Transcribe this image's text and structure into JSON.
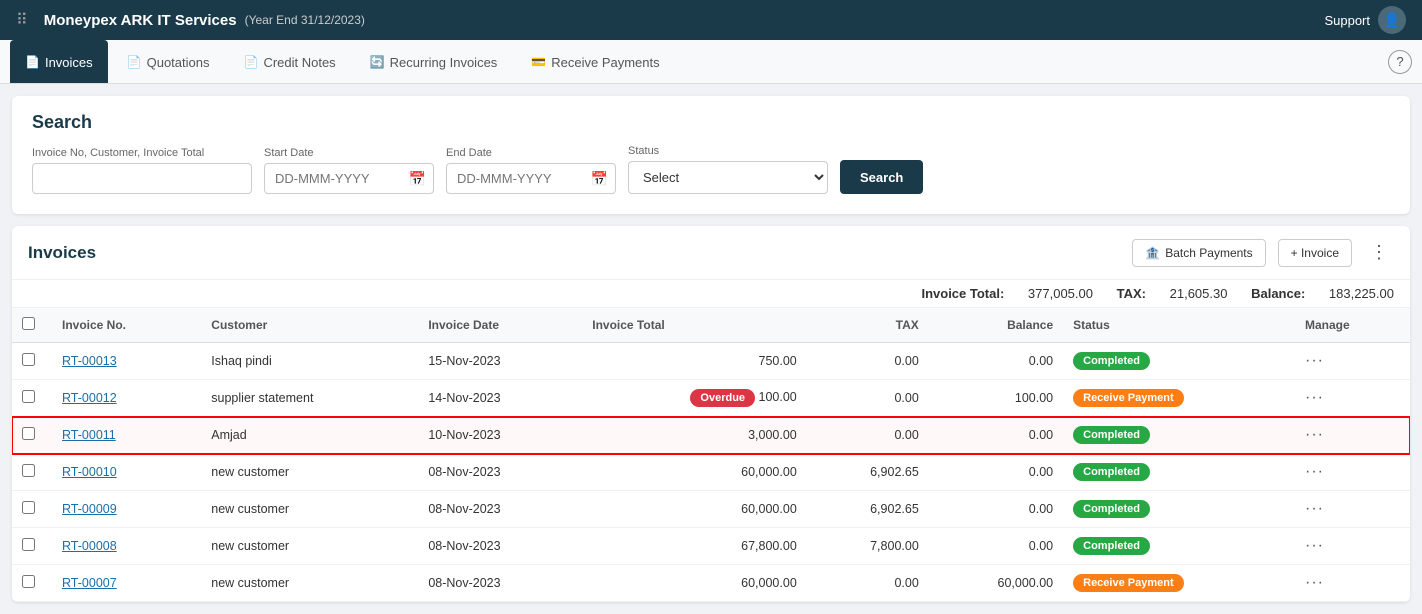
{
  "app": {
    "title": "Moneypex ARK IT Services",
    "subtitle": "(Year End 31/12/2023)",
    "support_label": "Support"
  },
  "tabs": [
    {
      "id": "invoices",
      "label": "Invoices",
      "active": true,
      "icon": "📄"
    },
    {
      "id": "quotations",
      "label": "Quotations",
      "active": false,
      "icon": "📄"
    },
    {
      "id": "credit-notes",
      "label": "Credit Notes",
      "active": false,
      "icon": "📄"
    },
    {
      "id": "recurring-invoices",
      "label": "Recurring Invoices",
      "active": false,
      "icon": "🔄"
    },
    {
      "id": "receive-payments",
      "label": "Receive Payments",
      "active": false,
      "icon": "💳"
    }
  ],
  "search": {
    "title": "Search",
    "invoice_label": "Invoice No, Customer, Invoice Total",
    "invoice_placeholder": "",
    "start_date_label": "Start Date",
    "start_date_placeholder": "DD-MMM-YYYY",
    "end_date_label": "End Date",
    "end_date_placeholder": "DD-MMM-YYYY",
    "status_label": "Status",
    "status_placeholder": "Select",
    "search_button": "Search"
  },
  "invoices_section": {
    "title": "Invoices",
    "batch_payments_label": "Batch Payments",
    "add_invoice_label": "+ Invoice",
    "totals": {
      "invoice_total_label": "Invoice Total:",
      "invoice_total_value": "377,005.00",
      "tax_label": "TAX:",
      "tax_value": "21,605.30",
      "balance_label": "Balance:",
      "balance_value": "183,225.00"
    },
    "columns": [
      {
        "id": "checkbox",
        "label": ""
      },
      {
        "id": "invoice_no",
        "label": "Invoice No."
      },
      {
        "id": "customer",
        "label": "Customer"
      },
      {
        "id": "invoice_date",
        "label": "Invoice Date"
      },
      {
        "id": "invoice_total",
        "label": "Invoice Total"
      },
      {
        "id": "tax",
        "label": "TAX"
      },
      {
        "id": "balance",
        "label": "Balance"
      },
      {
        "id": "status",
        "label": "Status"
      },
      {
        "id": "manage",
        "label": "Manage"
      }
    ],
    "rows": [
      {
        "id": "RT-00013",
        "customer": "Ishaq pindi",
        "date": "15-Nov-2023",
        "invoice_total": "750.00",
        "tax": "0.00",
        "balance": "0.00",
        "status": "Completed",
        "status_type": "completed",
        "highlighted": false
      },
      {
        "id": "RT-00012",
        "customer": "supplier statement",
        "date": "14-Nov-2023",
        "invoice_total": "100.00",
        "tax": "0.00",
        "balance": "100.00",
        "status": "Receive Payment",
        "status_type": "receive",
        "overdue": true,
        "highlighted": false
      },
      {
        "id": "RT-00011",
        "customer": "Amjad",
        "date": "10-Nov-2023",
        "invoice_total": "3,000.00",
        "tax": "0.00",
        "balance": "0.00",
        "status": "Completed",
        "status_type": "completed",
        "highlighted": true
      },
      {
        "id": "RT-00010",
        "customer": "new customer",
        "date": "08-Nov-2023",
        "invoice_total": "60,000.00",
        "tax": "6,902.65",
        "balance": "0.00",
        "status": "Completed",
        "status_type": "completed",
        "highlighted": false
      },
      {
        "id": "RT-00009",
        "customer": "new customer",
        "date": "08-Nov-2023",
        "invoice_total": "60,000.00",
        "tax": "6,902.65",
        "balance": "0.00",
        "status": "Completed",
        "status_type": "completed",
        "highlighted": false
      },
      {
        "id": "RT-00008",
        "customer": "new customer",
        "date": "08-Nov-2023",
        "invoice_total": "67,800.00",
        "tax": "7,800.00",
        "balance": "0.00",
        "status": "Completed",
        "status_type": "completed",
        "highlighted": false
      },
      {
        "id": "RT-00007",
        "customer": "new customer",
        "date": "08-Nov-2023",
        "invoice_total": "60,000.00",
        "tax": "0.00",
        "balance": "60,000.00",
        "status": "Receive Payment",
        "status_type": "receive",
        "highlighted": false
      }
    ]
  }
}
